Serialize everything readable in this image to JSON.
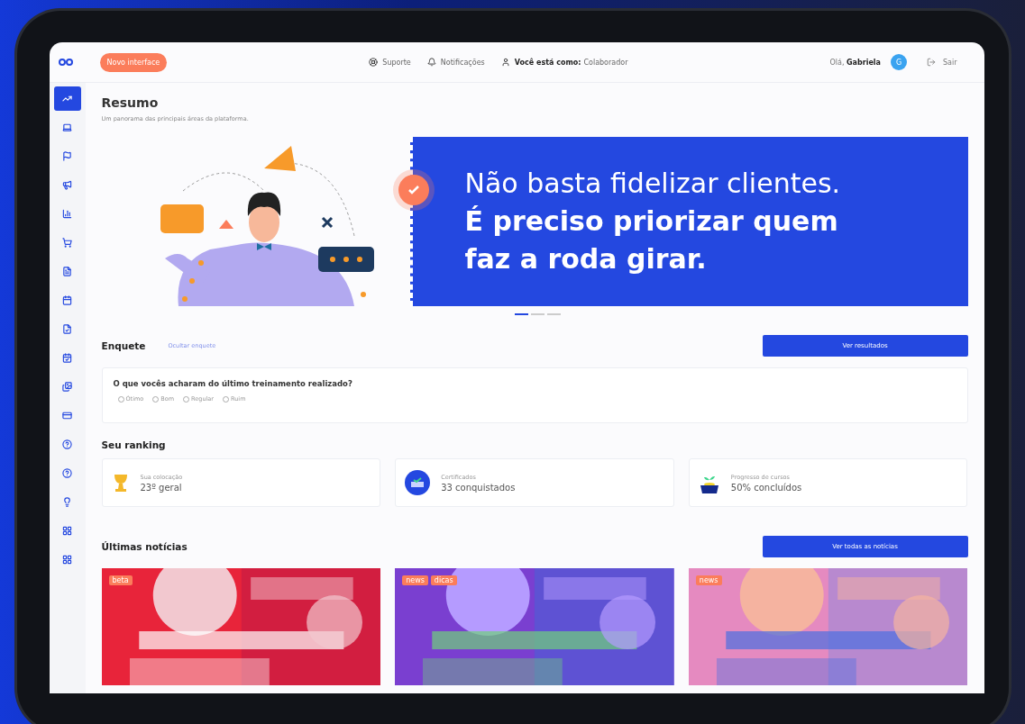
{
  "topbar": {
    "badge": "Novo interface",
    "links": [
      {
        "kind": "support",
        "label": "Suporte"
      },
      {
        "kind": "bell",
        "label": "Notificações"
      },
      {
        "kind": "user",
        "label": "Você está como:",
        "value": "Colaborador"
      }
    ],
    "greeting": "Olá,",
    "user": "Gabriela",
    "avatar": "G",
    "logout": "Sair"
  },
  "sidebar": {
    "items": [
      {
        "kind": "trend",
        "selected": true
      },
      {
        "kind": "laptop",
        "selected": false
      },
      {
        "kind": "flag",
        "selected": false
      },
      {
        "kind": "megaphone",
        "selected": false
      },
      {
        "kind": "bars",
        "selected": false
      },
      {
        "kind": "cart",
        "selected": false
      },
      {
        "kind": "file",
        "selected": false
      },
      {
        "kind": "calendar",
        "selected": false
      },
      {
        "kind": "filecheck",
        "selected": false
      },
      {
        "kind": "calendarcheck",
        "selected": false
      },
      {
        "kind": "images",
        "selected": false
      },
      {
        "kind": "card",
        "selected": false
      },
      {
        "kind": "help",
        "selected": false
      },
      {
        "kind": "help",
        "selected": false
      },
      {
        "kind": "bulb",
        "selected": false
      },
      {
        "kind": "grid",
        "selected": false
      },
      {
        "kind": "grid",
        "selected": false
      }
    ]
  },
  "summary": {
    "title": "Resumo",
    "subtitle": "Um panorama das principais áreas da plataforma."
  },
  "banner": {
    "line1": "Não basta fidelizar clientes.",
    "line2": "É preciso priorizar quem",
    "line3": "faz a roda girar.",
    "dots": [
      {
        "selected": true
      },
      {
        "selected": false
      },
      {
        "selected": false
      }
    ]
  },
  "poll": {
    "title": "Enquete",
    "hide_link": "Ocultar enquete",
    "button": "Ver resultados",
    "question": "O que vocês acharam do último treinamento realizado?",
    "options": [
      {
        "label": "Ótimo",
        "selected": false
      },
      {
        "label": "Bom",
        "selected": false
      },
      {
        "label": "Regular",
        "selected": false
      },
      {
        "label": "Ruim",
        "selected": false
      }
    ]
  },
  "ranking": {
    "title": "Seu ranking",
    "cards": [
      {
        "kind": "trophy",
        "label": "Sua colocação",
        "value": "23º geral"
      },
      {
        "kind": "certificate",
        "label": "Certificados",
        "value": "33 conquistados"
      },
      {
        "kind": "plant",
        "label": "Progresso de cursos",
        "value": "50% concluídos"
      }
    ]
  },
  "news": {
    "title": "Últimas notícias",
    "button": "Ver todas as notícias",
    "cards": [
      {
        "kind": "red",
        "tags": [
          "beta"
        ]
      },
      {
        "kind": "purple",
        "tags": [
          "news",
          "dicas"
        ]
      },
      {
        "kind": "pink",
        "tags": [
          "news"
        ]
      }
    ]
  }
}
